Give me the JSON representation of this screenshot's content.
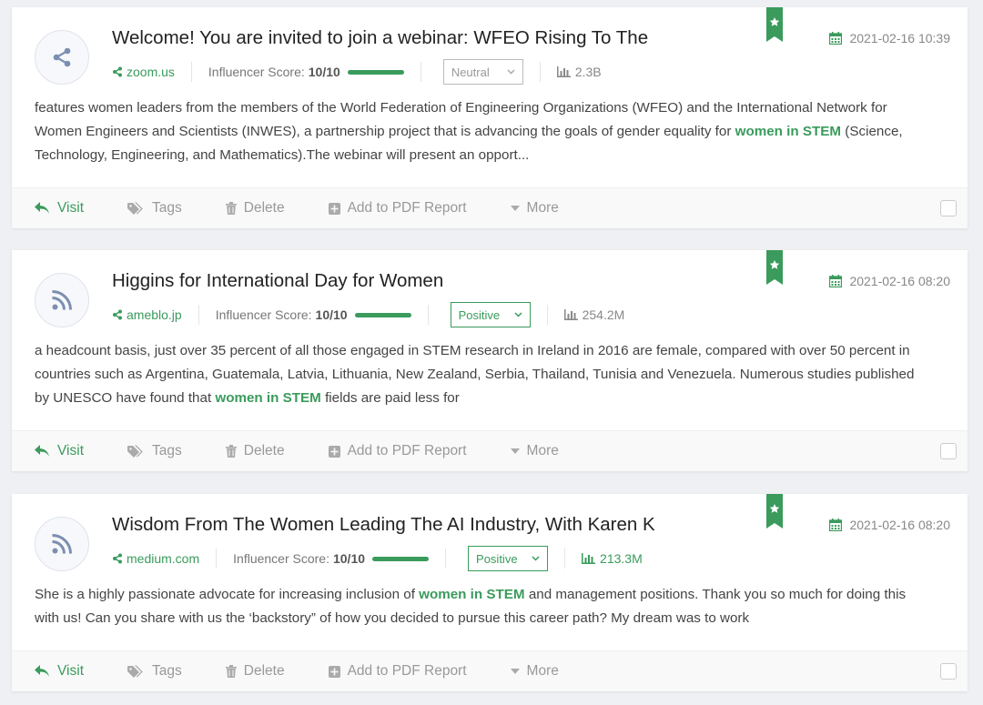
{
  "colors": {
    "accent": "#3a9b5c",
    "neutral": "#999999"
  },
  "actions": {
    "visit": "Visit",
    "tags": "Tags",
    "delete": "Delete",
    "pdf": "Add to PDF Report",
    "more": "More"
  },
  "score_label": "Influencer Score:",
  "mentions": [
    {
      "icon": "share-icon",
      "title": "Welcome! You are invited to join a webinar: WFEO Rising To The",
      "source": "zoom.us",
      "score": "10/10",
      "sentiment": "Neutral",
      "reach": "2.3B",
      "date": "2021-02-16 10:39",
      "snippet": [
        {
          "t": "features women leaders from the members of the World Federation of Engineering Organizations (WFEO) and the International Network for Women Engineers and Scientists (INWES), a partnership project that is advancing the goals of gender equality for "
        },
        {
          "t": "women in STEM",
          "hl": true
        },
        {
          "t": " (Science, Technology, Engineering, and Mathematics).The webinar will present an opport..."
        }
      ]
    },
    {
      "icon": "rss-icon",
      "title": "Higgins for International Day for Women",
      "source": "ameblo.jp",
      "score": "10/10",
      "sentiment": "Positive",
      "reach": "254.2M",
      "date": "2021-02-16 08:20",
      "snippet": [
        {
          "t": "a headcount basis, just over 35 percent of all those engaged in STEM research in Ireland in 2016 are female, compared with over 50 percent in countries such as Argentina, Guatemala, Latvia, Lithuania, New Zealand, Serbia, Thailand, Tunisia and Venezuela.  Numerous studies published by UNESCO have found that "
        },
        {
          "t": "women in STEM",
          "hl": true
        },
        {
          "t": " fields are paid less for"
        }
      ]
    },
    {
      "icon": "rss-icon",
      "title": "Wisdom From The Women Leading The AI Industry, With Karen K",
      "source": "medium.com",
      "score": "10/10",
      "sentiment": "Positive",
      "reach": "213.3M",
      "date": "2021-02-16 08:20",
      "snippet": [
        {
          "t": "She is a highly passionate advocate for increasing inclusion of "
        },
        {
          "t": "women in STEM",
          "hl": true
        },
        {
          "t": " and management positions. Thank you so much for doing this with us! Can you share with us the ‘backstory” of how you decided to pursue this career path? My dream was to work"
        }
      ]
    }
  ]
}
